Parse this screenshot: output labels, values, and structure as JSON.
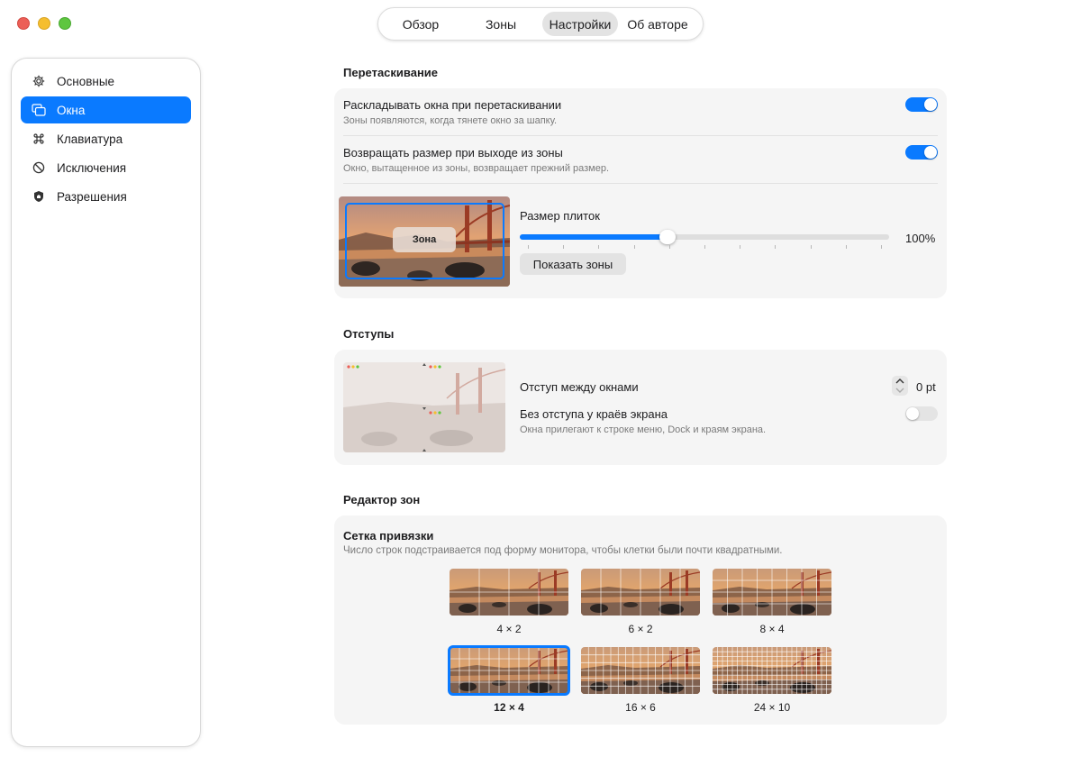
{
  "top_tabs": [
    {
      "label": "Обзор",
      "active": false
    },
    {
      "label": "Зоны",
      "active": false
    },
    {
      "label": "Настройки",
      "active": true
    },
    {
      "label": "Об авторе",
      "active": false
    }
  ],
  "sidebar": {
    "items": [
      {
        "label": "Основные",
        "icon": "gear-icon",
        "active": false
      },
      {
        "label": "Окна",
        "icon": "windows-icon",
        "active": true
      },
      {
        "label": "Клавиатура",
        "icon": "command-icon",
        "active": false
      },
      {
        "label": "Исключения",
        "icon": "prohibited-icon",
        "active": false
      },
      {
        "label": "Разрешения",
        "icon": "shield-icon",
        "active": false
      }
    ]
  },
  "drag": {
    "title": "Перетаскивание",
    "snap_title": "Раскладывать окна при перетаскивании",
    "snap_desc": "Зоны появляются, когда тянете окно за шапку.",
    "snap_on": true,
    "restore_title": "Возвращать размер при выходе из зоны",
    "restore_desc": "Окно, вытащенное из зоны, возвращает прежний размер.",
    "restore_on": true,
    "zone_label": "Зона",
    "tile_size_label": "Размер плиток",
    "tile_size_value": "100%",
    "tile_size_fraction": 0.4,
    "show_zones_button": "Показать зоны"
  },
  "gaps": {
    "title": "Отступы",
    "gap_label": "Отступ между окнами",
    "gap_value": "0 pt",
    "edge_title": "Без отступа у краёв экрана",
    "edge_desc": "Окна прилегают к строке меню, Dock и краям экрана.",
    "edge_on": false
  },
  "editor": {
    "title": "Редактор зон",
    "grid_title": "Сетка привязки",
    "grid_desc": "Число строк подстраивается под форму монитора, чтобы клетки были почти квадратными.",
    "options": [
      {
        "label": "4 × 2",
        "cols": 4,
        "rows": 2,
        "selected": false
      },
      {
        "label": "6 × 2",
        "cols": 6,
        "rows": 2,
        "selected": false
      },
      {
        "label": "8 × 4",
        "cols": 8,
        "rows": 4,
        "selected": false
      },
      {
        "label": "12 × 4",
        "cols": 12,
        "rows": 4,
        "selected": true
      },
      {
        "label": "16 × 6",
        "cols": 16,
        "rows": 6,
        "selected": false
      },
      {
        "label": "24 × 10",
        "cols": 24,
        "rows": 10,
        "selected": false
      }
    ]
  },
  "colors": {
    "accent": "#0a7aff",
    "card_bg": "#f5f5f5"
  }
}
